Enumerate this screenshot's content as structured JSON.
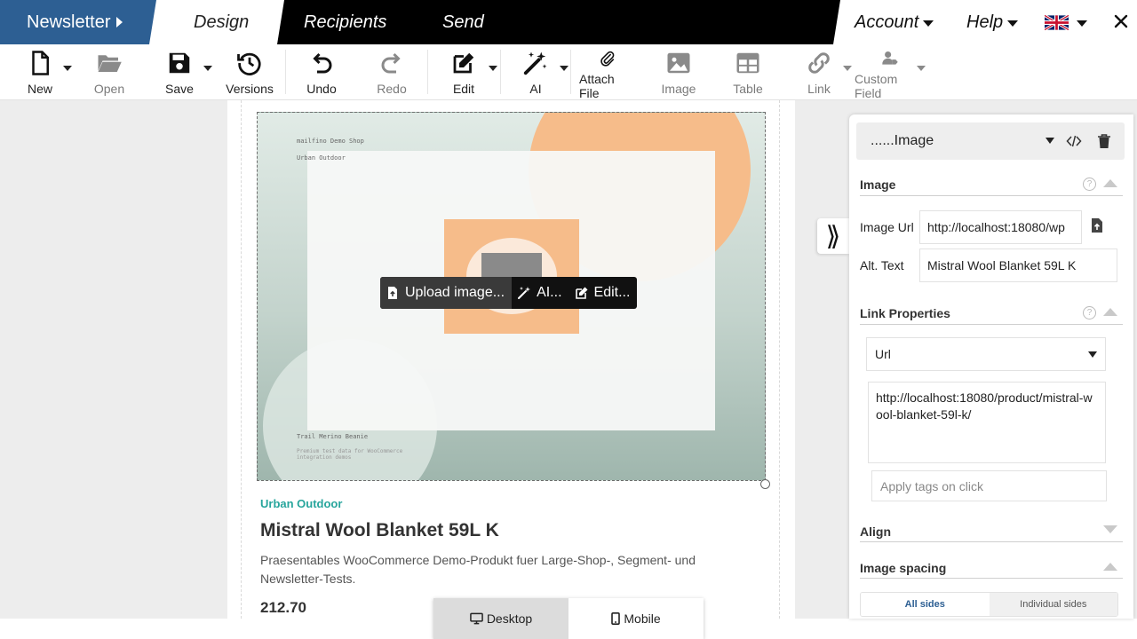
{
  "topbar": {
    "brand": "Newsletter",
    "tabs": [
      {
        "label": "Design"
      },
      {
        "label": "Recipients"
      },
      {
        "label": "Send"
      }
    ],
    "account_label": "Account",
    "help_label": "Help"
  },
  "toolbar": {
    "new": "New",
    "open": "Open",
    "save": "Save",
    "versions": "Versions",
    "undo": "Undo",
    "redo": "Redo",
    "edit": "Edit",
    "ai": "AI",
    "attach": "Attach File",
    "image": "Image",
    "table": "Table",
    "link": "Link",
    "custom_field": "Custom Field"
  },
  "email": {
    "image_text_shop": "mailfino Demo Shop",
    "image_text_vendor": "Urban Outdoor",
    "image_text_product": "Trail Merino Beanie",
    "image_text_desc": "Premium test data for WooCommerce integration demos",
    "overlay": {
      "upload": "Upload image...",
      "ai": "AI...",
      "edit": "Edit..."
    },
    "vendor": "Urban Outdoor",
    "title": "Mistral Wool Blanket 59L K",
    "description": "Praesentables WooCommerce Demo-Produkt fuer Large-Shop-, Segment- und Newsletter-Tests.",
    "price": "212.70"
  },
  "view_switch": {
    "desktop": "Desktop",
    "mobile": "Mobile"
  },
  "panel": {
    "collapse_glyph": "⟫",
    "block_title": "......Image",
    "image_section": "Image",
    "image_url_label": "Image Url",
    "image_url_value": "http://localhost:18080/wp",
    "alt_label": "Alt. Text",
    "alt_value": "Mistral Wool Blanket 59L K",
    "link_section": "Link Properties",
    "link_type": "Url",
    "link_url": "http://localhost:18080/product/mistral-wool-blanket-59l-k/",
    "tags_placeholder": "Apply tags on click",
    "align_section": "Align",
    "spacing_section": "Image spacing",
    "spacing_tabs": [
      "All sides",
      "Individual sides"
    ]
  },
  "colors": {
    "brand_blue": "#2d5f93",
    "vendor_teal": "#27a59c",
    "peach": "#f6bc8a"
  }
}
